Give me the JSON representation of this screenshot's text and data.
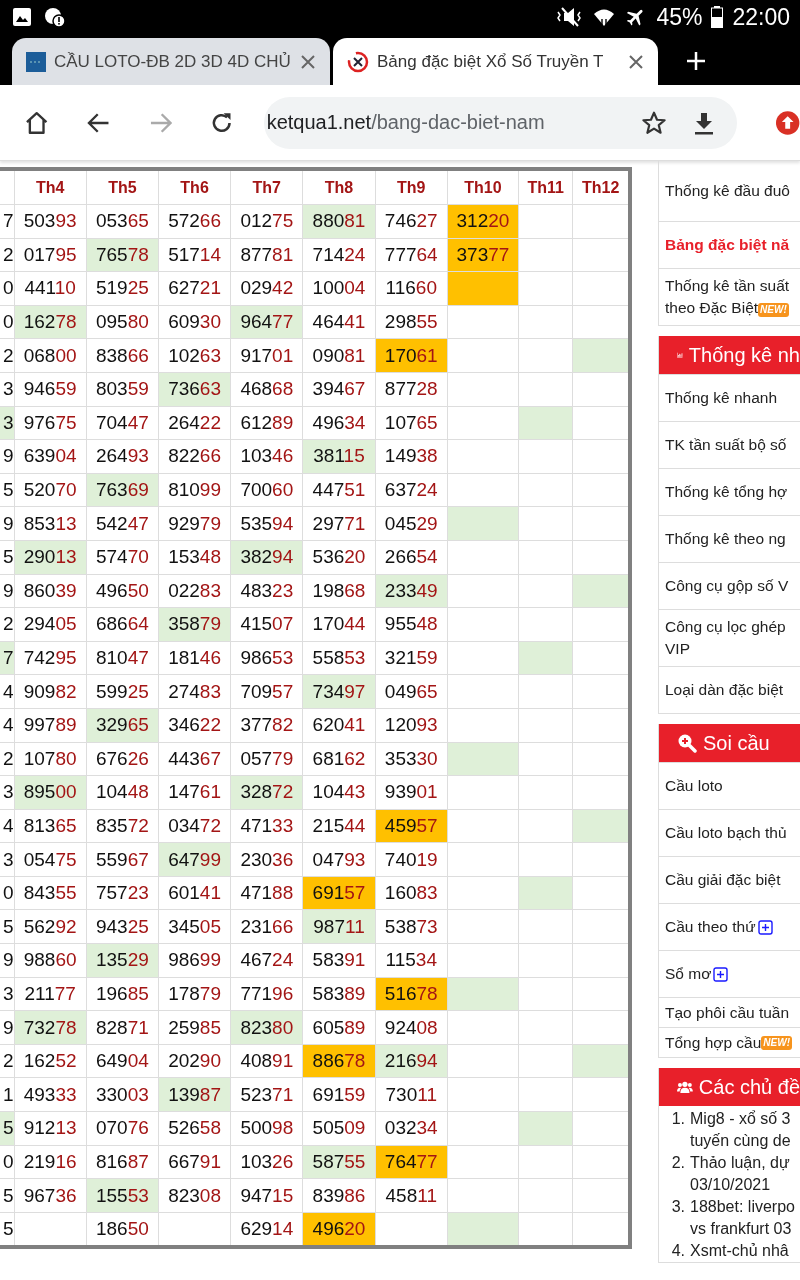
{
  "status_bar": {
    "battery": "45%",
    "time": "22:00"
  },
  "tabs": [
    {
      "title": "CẦU LOTO-ĐB 2D 3D 4D CHỦ",
      "selected": false
    },
    {
      "title": "Bảng đặc biệt Xổ Số Truyền T",
      "selected": true
    }
  ],
  "toolbar": {
    "url_host": "ketqua1.net",
    "url_path": "/bang-dac-biet-nam",
    "forward_disabled": true
  },
  "table": {
    "columns": [
      "Th4",
      "Th5",
      "Th6",
      "Th7",
      "Th8",
      "Th9",
      "Th10",
      "Th11",
      "Th12"
    ],
    "rows": [
      {
        "cut_cell": {
          "text": "7"
        },
        "cells": [
          {
            "text": "50393"
          },
          {
            "text": "05365"
          },
          {
            "text": "57266"
          },
          {
            "text": "01275"
          },
          {
            "text": "88081",
            "color": "#dff0d8"
          },
          {
            "text": "74627"
          },
          {
            "text": "31220",
            "color": "#ffc000"
          },
          {},
          {}
        ]
      },
      {
        "cut_cell": {
          "text": "2"
        },
        "cells": [
          {
            "text": "01795"
          },
          {
            "text": "76578",
            "color": "#dff0d8"
          },
          {
            "text": "51714"
          },
          {
            "text": "87781"
          },
          {
            "text": "71424"
          },
          {
            "text": "77764"
          },
          {
            "text": "37377",
            "color": "#ffc000"
          },
          {},
          {}
        ]
      },
      {
        "cut_cell": {
          "text": "0"
        },
        "cells": [
          {
            "text": "44110"
          },
          {
            "text": "51925"
          },
          {
            "text": "62721"
          },
          {
            "text": "02942"
          },
          {
            "text": "10004"
          },
          {
            "text": "11660"
          },
          {
            "color": "#ffc000"
          },
          {},
          {}
        ]
      },
      {
        "cut_cell": {
          "text": "0"
        },
        "cells": [
          {
            "text": "16278",
            "color": "#dff0d8"
          },
          {
            "text": "09580"
          },
          {
            "text": "60930"
          },
          {
            "text": "96477",
            "color": "#dff0d8"
          },
          {
            "text": "46441"
          },
          {
            "text": "29855"
          },
          {},
          {},
          {}
        ]
      },
      {
        "cut_cell": {
          "text": "2"
        },
        "cells": [
          {
            "text": "06800"
          },
          {
            "text": "83866"
          },
          {
            "text": "10263"
          },
          {
            "text": "91701"
          },
          {
            "text": "09081"
          },
          {
            "text": "17061",
            "color": "#ffc000"
          },
          {},
          {},
          {
            "color": "#dff0d8"
          }
        ]
      },
      {
        "cut_cell": {
          "text": "3"
        },
        "cells": [
          {
            "text": "94659"
          },
          {
            "text": "80359"
          },
          {
            "text": "73663",
            "color": "#dff0d8"
          },
          {
            "text": "46868"
          },
          {
            "text": "39467"
          },
          {
            "text": "87728"
          },
          {},
          {},
          {}
        ]
      },
      {
        "cut_cell": {
          "text": "3",
          "color": "#dff0d8"
        },
        "cells": [
          {
            "text": "97675"
          },
          {
            "text": "70447"
          },
          {
            "text": "26422"
          },
          {
            "text": "61289"
          },
          {
            "text": "49634"
          },
          {
            "text": "10765"
          },
          {},
          {
            "color": "#dff0d8"
          },
          {}
        ]
      },
      {
        "cut_cell": {
          "text": "9"
        },
        "cells": [
          {
            "text": "63904"
          },
          {
            "text": "26493"
          },
          {
            "text": "82266"
          },
          {
            "text": "10346"
          },
          {
            "text": "38115",
            "color": "#dff0d8"
          },
          {
            "text": "14938"
          },
          {},
          {},
          {}
        ]
      },
      {
        "cut_cell": {
          "text": "5"
        },
        "cells": [
          {
            "text": "52070"
          },
          {
            "text": "76369",
            "color": "#dff0d8"
          },
          {
            "text": "81099"
          },
          {
            "text": "70060"
          },
          {
            "text": "44751"
          },
          {
            "text": "63724"
          },
          {},
          {},
          {}
        ]
      },
      {
        "cut_cell": {
          "text": "9"
        },
        "cells": [
          {
            "text": "85313"
          },
          {
            "text": "54247"
          },
          {
            "text": "92979"
          },
          {
            "text": "53594"
          },
          {
            "text": "29771"
          },
          {
            "text": "04529"
          },
          {
            "color": "#dff0d8"
          },
          {},
          {}
        ]
      },
      {
        "cut_cell": {
          "text": "5"
        },
        "cells": [
          {
            "text": "29013",
            "color": "#dff0d8"
          },
          {
            "text": "57470"
          },
          {
            "text": "15348"
          },
          {
            "text": "38294",
            "color": "#dff0d8"
          },
          {
            "text": "53620"
          },
          {
            "text": "26654"
          },
          {},
          {},
          {}
        ]
      },
      {
        "cut_cell": {
          "text": "9"
        },
        "cells": [
          {
            "text": "86039"
          },
          {
            "text": "49650"
          },
          {
            "text": "02283"
          },
          {
            "text": "48323"
          },
          {
            "text": "19868"
          },
          {
            "text": "23349",
            "color": "#dff0d8"
          },
          {},
          {},
          {
            "color": "#dff0d8"
          }
        ]
      },
      {
        "cut_cell": {
          "text": "2"
        },
        "cells": [
          {
            "text": "29405"
          },
          {
            "text": "68664"
          },
          {
            "text": "35879",
            "color": "#dff0d8"
          },
          {
            "text": "41507"
          },
          {
            "text": "17044"
          },
          {
            "text": "95548"
          },
          {},
          {},
          {}
        ]
      },
      {
        "cut_cell": {
          "text": "7",
          "color": "#dff0d8"
        },
        "cells": [
          {
            "text": "74295"
          },
          {
            "text": "81047"
          },
          {
            "text": "18146"
          },
          {
            "text": "98653"
          },
          {
            "text": "55853"
          },
          {
            "text": "32159"
          },
          {},
          {
            "color": "#dff0d8"
          },
          {}
        ]
      },
      {
        "cut_cell": {
          "text": "4"
        },
        "cells": [
          {
            "text": "90982"
          },
          {
            "text": "59925"
          },
          {
            "text": "27483"
          },
          {
            "text": "70957"
          },
          {
            "text": "73497",
            "color": "#dff0d8"
          },
          {
            "text": "04965"
          },
          {},
          {},
          {}
        ]
      },
      {
        "cut_cell": {
          "text": "4"
        },
        "cells": [
          {
            "text": "99789"
          },
          {
            "text": "32965",
            "color": "#dff0d8"
          },
          {
            "text": "34622"
          },
          {
            "text": "37782"
          },
          {
            "text": "62041"
          },
          {
            "text": "12093"
          },
          {},
          {},
          {}
        ]
      },
      {
        "cut_cell": {
          "text": "2"
        },
        "cells": [
          {
            "text": "10780"
          },
          {
            "text": "67626"
          },
          {
            "text": "44367"
          },
          {
            "text": "05779"
          },
          {
            "text": "68162"
          },
          {
            "text": "35330"
          },
          {
            "color": "#dff0d8"
          },
          {},
          {}
        ]
      },
      {
        "cut_cell": {
          "text": "3"
        },
        "cells": [
          {
            "text": "89500",
            "color": "#dff0d8"
          },
          {
            "text": "10448"
          },
          {
            "text": "14761"
          },
          {
            "text": "32872",
            "color": "#dff0d8"
          },
          {
            "text": "10443"
          },
          {
            "text": "93901"
          },
          {},
          {},
          {}
        ]
      },
      {
        "cut_cell": {
          "text": "4"
        },
        "cells": [
          {
            "text": "81365"
          },
          {
            "text": "83572"
          },
          {
            "text": "03472"
          },
          {
            "text": "47133"
          },
          {
            "text": "21544"
          },
          {
            "text": "45957",
            "color": "#ffc000"
          },
          {},
          {},
          {
            "color": "#dff0d8"
          }
        ]
      },
      {
        "cut_cell": {
          "text": "3"
        },
        "cells": [
          {
            "text": "05475"
          },
          {
            "text": "55967"
          },
          {
            "text": "64799",
            "color": "#dff0d8"
          },
          {
            "text": "23036"
          },
          {
            "text": "04793"
          },
          {
            "text": "74019"
          },
          {},
          {},
          {}
        ]
      },
      {
        "cut_cell": {
          "text": "0"
        },
        "cells": [
          {
            "text": "84355"
          },
          {
            "text": "75723"
          },
          {
            "text": "60141"
          },
          {
            "text": "47188"
          },
          {
            "text": "69157",
            "color": "#ffc000"
          },
          {
            "text": "16083"
          },
          {},
          {
            "color": "#dff0d8"
          },
          {}
        ]
      },
      {
        "cut_cell": {
          "text": "5"
        },
        "cells": [
          {
            "text": "56292"
          },
          {
            "text": "94325"
          },
          {
            "text": "34505"
          },
          {
            "text": "23166"
          },
          {
            "text": "98711",
            "color": "#dff0d8"
          },
          {
            "text": "53873"
          },
          {},
          {},
          {}
        ]
      },
      {
        "cut_cell": {
          "text": "9"
        },
        "cells": [
          {
            "text": "98860"
          },
          {
            "text": "13529",
            "color": "#dff0d8"
          },
          {
            "text": "98699"
          },
          {
            "text": "46724"
          },
          {
            "text": "58391"
          },
          {
            "text": "11534"
          },
          {},
          {},
          {}
        ]
      },
      {
        "cut_cell": {
          "text": "3"
        },
        "cells": [
          {
            "text": "21177"
          },
          {
            "text": "19685"
          },
          {
            "text": "17879"
          },
          {
            "text": "77196"
          },
          {
            "text": "58389"
          },
          {
            "text": "51678",
            "color": "#ffc000"
          },
          {
            "color": "#dff0d8"
          },
          {},
          {}
        ]
      },
      {
        "cut_cell": {
          "text": "9"
        },
        "cells": [
          {
            "text": "73278",
            "color": "#dff0d8"
          },
          {
            "text": "82871"
          },
          {
            "text": "25985"
          },
          {
            "text": "82380",
            "color": "#dff0d8"
          },
          {
            "text": "60589"
          },
          {
            "text": "92408"
          },
          {},
          {},
          {}
        ]
      },
      {
        "cut_cell": {
          "text": "2"
        },
        "cells": [
          {
            "text": "16252"
          },
          {
            "text": "64904"
          },
          {
            "text": "20290"
          },
          {
            "text": "40891"
          },
          {
            "text": "88678",
            "color": "#ffc000"
          },
          {
            "text": "21694",
            "color": "#dff0d8"
          },
          {},
          {},
          {
            "color": "#dff0d8"
          }
        ]
      },
      {
        "cut_cell": {
          "text": "1"
        },
        "cells": [
          {
            "text": "49333"
          },
          {
            "text": "33003"
          },
          {
            "text": "13987",
            "color": "#dff0d8"
          },
          {
            "text": "52371"
          },
          {
            "text": "69159"
          },
          {
            "text": "73011"
          },
          {},
          {},
          {}
        ]
      },
      {
        "cut_cell": {
          "text": "5",
          "color": "#dff0d8"
        },
        "cells": [
          {
            "text": "91213"
          },
          {
            "text": "07076"
          },
          {
            "text": "52658"
          },
          {
            "text": "50098"
          },
          {
            "text": "50509"
          },
          {
            "text": "03234"
          },
          {},
          {
            "color": "#dff0d8"
          },
          {}
        ]
      },
      {
        "cut_cell": {
          "text": "0"
        },
        "cells": [
          {
            "text": "21916"
          },
          {
            "text": "81687"
          },
          {
            "text": "66791"
          },
          {
            "text": "10326"
          },
          {
            "text": "58755",
            "color": "#dff0d8"
          },
          {
            "text": "76477",
            "color": "#ffc000"
          },
          {},
          {},
          {}
        ]
      },
      {
        "cut_cell": {
          "text": "5"
        },
        "cells": [
          {
            "text": "96736"
          },
          {
            "text": "15553",
            "color": "#dff0d8"
          },
          {
            "text": "82308"
          },
          {
            "text": "94715"
          },
          {
            "text": "83986"
          },
          {
            "text": "45811"
          },
          {},
          {},
          {}
        ]
      },
      {
        "cut_cell": {
          "text": "5"
        },
        "cells": [
          {},
          {
            "text": "18650"
          },
          {},
          {
            "text": "62914"
          },
          {
            "text": "49620",
            "color": "#ffc000"
          },
          {},
          {
            "color": "#dff0d8"
          },
          {},
          {}
        ]
      }
    ]
  },
  "sidebar": {
    "links": [
      {
        "label": "Thống kê đầu đuô",
        "active": false
      },
      {
        "label": "Bảng đặc biệt nă",
        "active": true
      },
      {
        "lines": [
          "Thống kê tần suất",
          "theo Đặc Biệt"
        ],
        "badge": "NEW!",
        "active": false
      }
    ],
    "sections": [
      {
        "title": "Thống kê nh",
        "kind": "chart",
        "items": [
          {
            "label": "Thống kê nhanh"
          },
          {
            "label": "TK tần suất bộ số"
          },
          {
            "label": "Thống kê tổng hợ"
          },
          {
            "label": "Thống kê theo ng"
          },
          {
            "label": "Công cụ gộp số V"
          },
          {
            "lines": [
              "Công cụ lọc ghép",
              "VIP"
            ]
          },
          {
            "label": "Loại dàn đặc biệt"
          }
        ]
      },
      {
        "title": "Soi cầu",
        "kind": "search",
        "items": [
          {
            "label": "Cầu loto",
            "expandable": false
          },
          {
            "label": "Cầu loto bạch thủ",
            "expandable": false
          },
          {
            "label": "Cầu giải đặc biệt",
            "expandable": false
          },
          {
            "label": "Cầu theo thứ",
            "expandable": true
          },
          {
            "label": "Sổ mơ",
            "expandable": true
          },
          {
            "label": "Tạo phôi cầu tuần",
            "expandable": false
          },
          {
            "label": "Tổng hợp cầu",
            "badge": "NEW!",
            "expandable": false
          }
        ]
      },
      {
        "title": "Các chủ đề",
        "kind": "group",
        "topics": [
          {
            "number": "1.",
            "lines": [
              "Mig8 - xổ số 3",
              "tuyến cùng de"
            ]
          },
          {
            "number": "2.",
            "lines": [
              "Thảo luận, dự",
              "03/10/2021"
            ]
          },
          {
            "number": "3.",
            "lines": [
              "188bet: liverpo",
              "vs frankfurt 03"
            ]
          },
          {
            "number": "4.",
            "lines": [
              "Xsmt-chủ nhâ"
            ]
          }
        ]
      }
    ]
  }
}
